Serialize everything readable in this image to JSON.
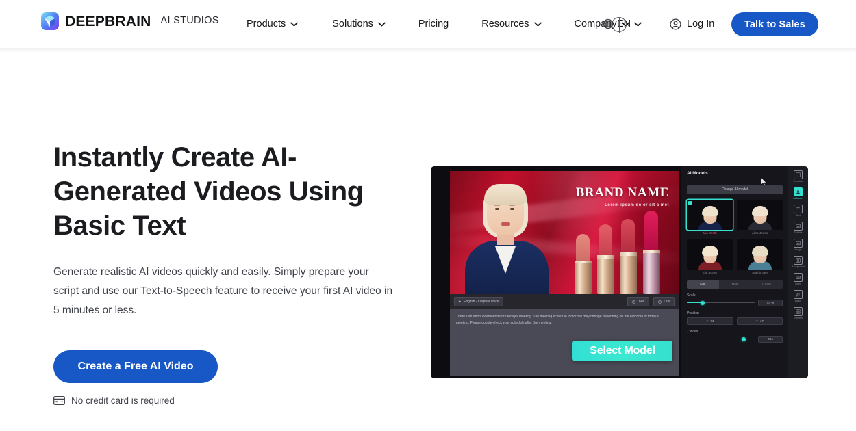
{
  "header": {
    "brand": {
      "name": "DEEPBRAIN",
      "sub": "AI STUDIOS",
      "icon": "cube-logo-icon"
    },
    "nav": [
      {
        "label": "Products",
        "has_chevron": true
      },
      {
        "label": "Solutions",
        "has_chevron": true
      },
      {
        "label": "Pricing",
        "has_chevron": false
      },
      {
        "label": "Resources",
        "has_chevron": true
      },
      {
        "label": "Company",
        "has_chevron": true
      }
    ],
    "language": {
      "label": "EN",
      "icon": "globe-icon"
    },
    "login": {
      "label": "Log In",
      "icon": "user-circle-icon"
    },
    "cta": {
      "label": "Talk to Sales",
      "color": "#1758c6"
    }
  },
  "hero": {
    "title": "Instantly Create AI-Generated Videos Using Basic Text",
    "subtitle": "Generate realistic AI videos quickly and easily. Simply prepare your script and use our Text-to-Speech feature to receive your first AI video in 5 minutes or less.",
    "cta_label": "Create a Free AI Video",
    "note": "No credit card is required",
    "note_icon": "credit-card-icon"
  },
  "mockup": {
    "canvas": {
      "brand_title": "BRAND NAME",
      "brand_tagline": "Lorem ipsum dolor sit a met"
    },
    "toolbar": {
      "voice_chip": "English - Original Voice",
      "voice_icon": "wave-icon",
      "pills": [
        {
          "label": "0.4s",
          "icon": "clock-icon"
        },
        {
          "label": "1.0s",
          "icon": "clock-icon"
        }
      ]
    },
    "script": "There's an announcement before today's meeting. The meeting schedule tomorrow may change depending on the outcome of today's meeting. Please double-check your schedule after the meeting.",
    "select_model_button": "Select Model",
    "panel": {
      "title": "AI Models",
      "change_button": "Change AI model",
      "models": [
        {
          "name": "Mia Smith",
          "selected": true
        },
        {
          "name": "Alice Jones",
          "selected": false
        },
        {
          "name": "Ella Brown",
          "selected": false
        },
        {
          "name": "Sophia Lee",
          "selected": false
        }
      ],
      "tabs": [
        {
          "label": "Full",
          "active": true
        },
        {
          "label": "Half",
          "active": false
        },
        {
          "label": "Circle",
          "active": false
        }
      ],
      "controls": [
        {
          "label": "Scale",
          "value": "44 %"
        },
        {
          "label": "Position",
          "x": "24",
          "y": "47"
        },
        {
          "label": "Z index",
          "value": "404"
        }
      ]
    },
    "rail": [
      {
        "label": "Template",
        "icon": "template-icon",
        "active": false
      },
      {
        "label": "AI Model",
        "icon": "avatar-icon",
        "active": true
      },
      {
        "label": "Text",
        "icon": "text-icon",
        "active": false
      },
      {
        "label": "Subtitle",
        "icon": "subtitle-icon",
        "active": false
      },
      {
        "label": "Image",
        "icon": "image-icon",
        "active": false
      },
      {
        "label": "Background",
        "icon": "background-icon",
        "active": false
      },
      {
        "label": "Video",
        "icon": "video-icon",
        "active": false
      },
      {
        "label": "Audio",
        "icon": "audio-icon",
        "active": false
      },
      {
        "label": "Element",
        "icon": "element-icon",
        "active": false
      }
    ]
  },
  "colors": {
    "brand_blue": "#1758c6",
    "accent_teal": "#35e0cf"
  }
}
